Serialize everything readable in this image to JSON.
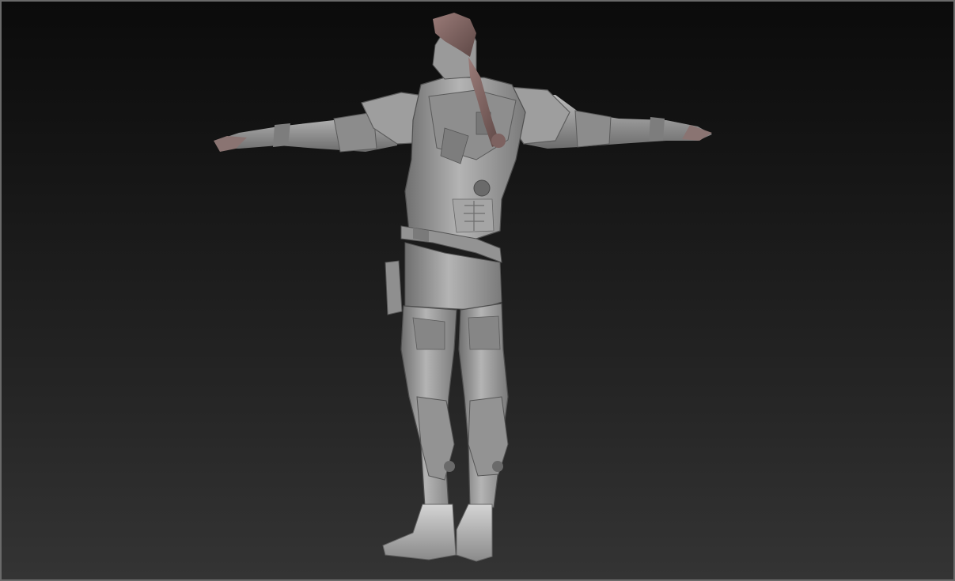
{
  "viewport": {
    "background_top": "#0b0b0b",
    "background_bottom": "#343434",
    "frame_color": "#6a6a6a"
  },
  "model": {
    "kind": "sculpted-figure-back-view",
    "pose": "t-pose",
    "material_color": "#a8a8a8",
    "hair_color": "#8a6e6c"
  }
}
